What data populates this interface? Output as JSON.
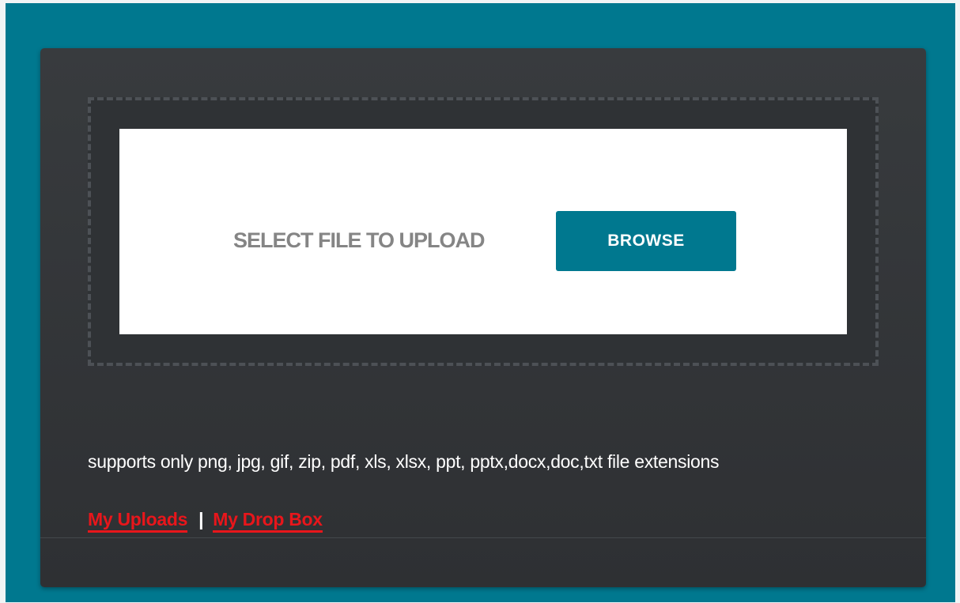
{
  "upload": {
    "select_label": "SELECT FILE TO UPLOAD",
    "browse_label": "BROWSE"
  },
  "info": {
    "supported_text": "supports only png, jpg, gif, zip, pdf, xls, xlsx, ppt, pptx,docx,doc,txt file extensions"
  },
  "links": {
    "my_uploads": "My Uploads",
    "separator": "|",
    "my_drop_box": "My Drop Box"
  },
  "colors": {
    "accent": "#00788f",
    "panel": "#323538",
    "link": "#e8161b",
    "label": "#858585"
  }
}
